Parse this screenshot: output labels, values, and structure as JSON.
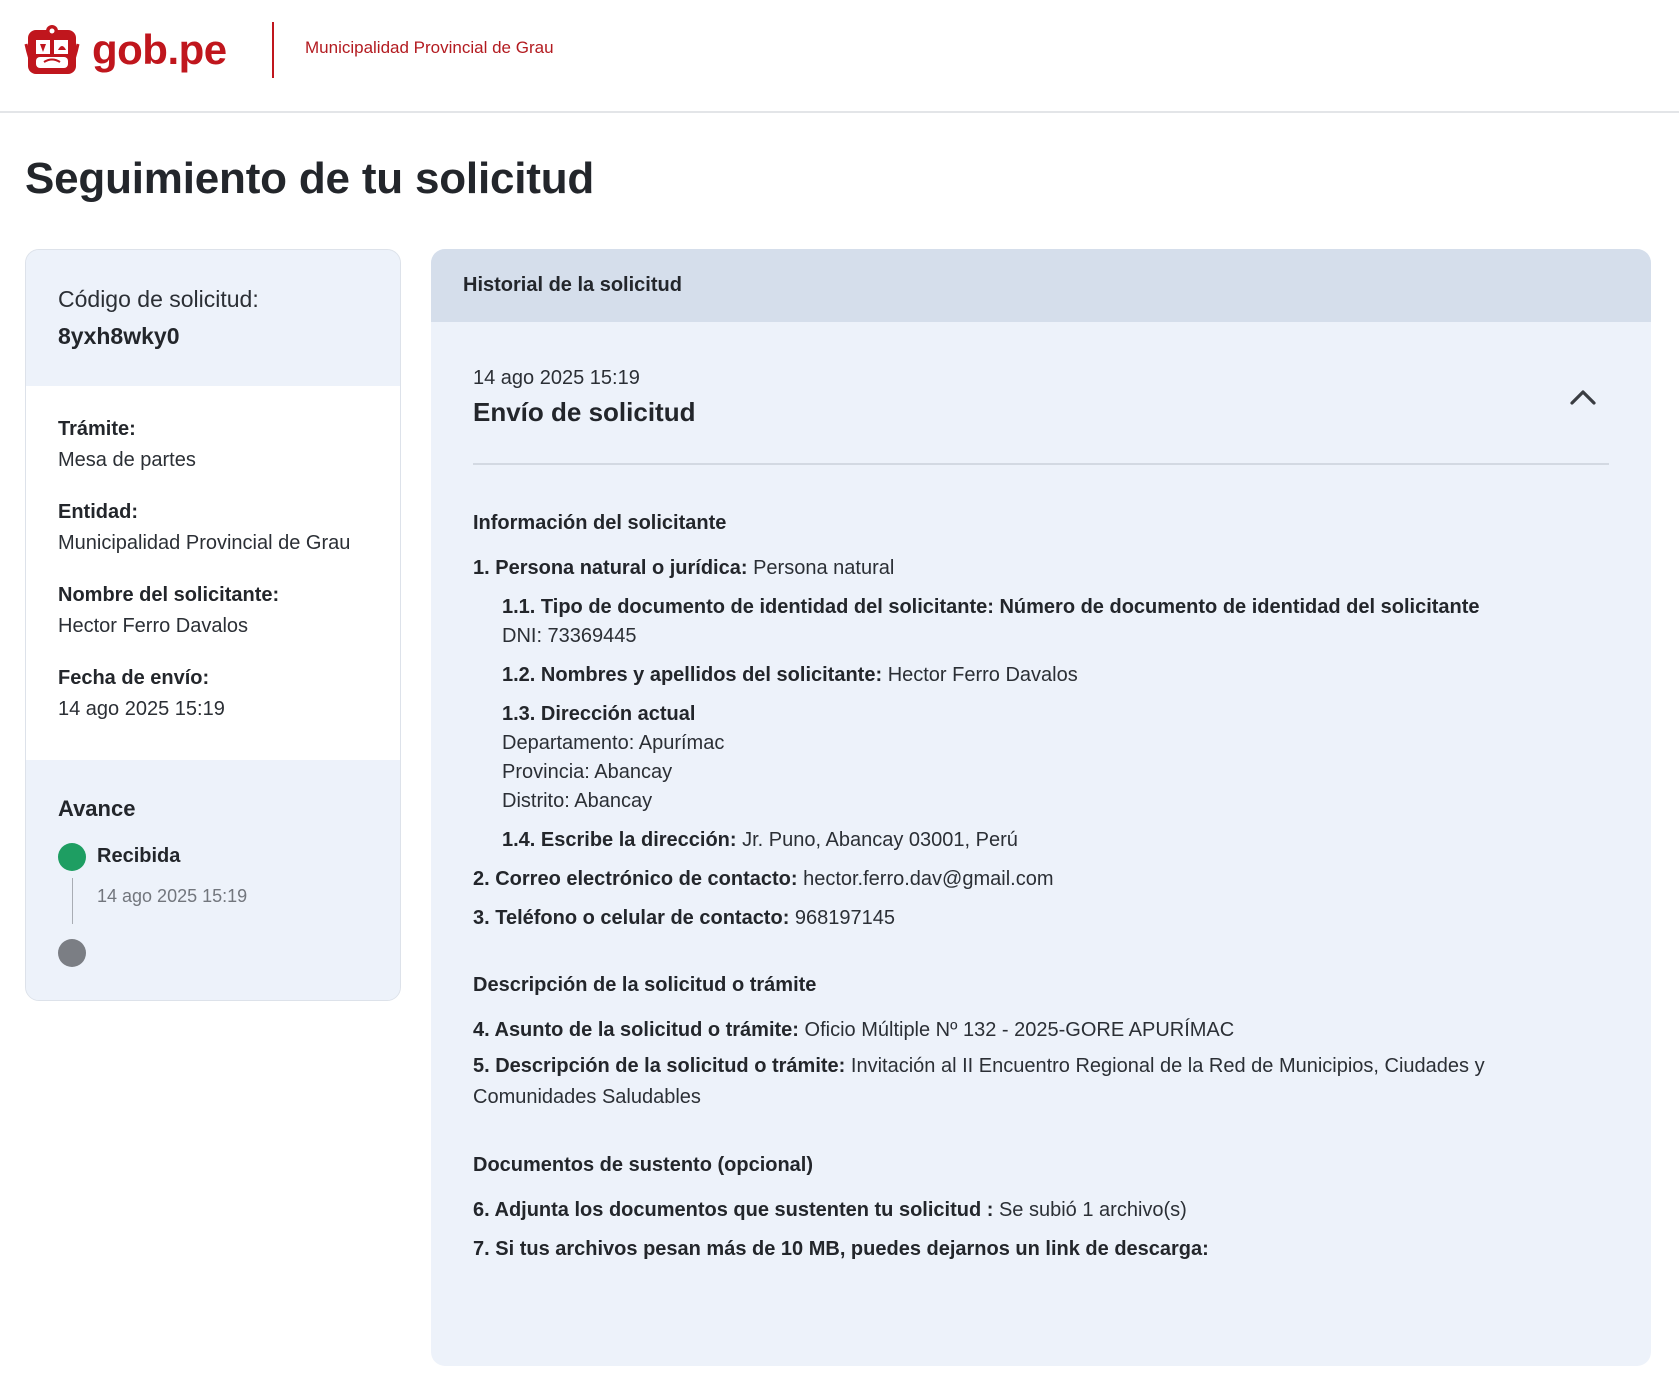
{
  "header": {
    "brand": "gob.pe",
    "entity_link": "Municipalidad Provincial de Grau"
  },
  "page_title": "Seguimiento de tu solicitud",
  "summary": {
    "code_label": "Código de solicitud:",
    "code_value": "8yxh8wky0",
    "details": [
      {
        "label": "Trámite:",
        "value": "Mesa de partes"
      },
      {
        "label": "Entidad:",
        "value": "Municipalidad Provincial de Grau"
      },
      {
        "label": "Nombre del solicitante:",
        "value": "Hector Ferro Davalos"
      },
      {
        "label": "Fecha de envío:",
        "value": "14 ago 2025 15:19"
      }
    ],
    "progress": {
      "title": "Avance",
      "steps": [
        {
          "label": "Recibida",
          "date": "14 ago 2025 15:19",
          "status": "done",
          "color": "#1e9e62"
        },
        {
          "label": "",
          "date": "",
          "status": "pending",
          "color": "#7b7e84"
        }
      ]
    }
  },
  "history": {
    "header": "Historial de la solicitud",
    "entry": {
      "date": "14 ago 2025 15:19",
      "title": "Envío de solicitud",
      "toggle_icon": "chevron-up-icon",
      "applicant_section": "Información del solicitante",
      "q1_label": "1. Persona natural o jurídica:",
      "q1_value": "Persona natural",
      "q11_label": "1.1. Tipo de documento de identidad del solicitante: Número de documento de identidad del solicitante",
      "q11_value": "DNI: 73369445",
      "q12_label": "1.2. Nombres y apellidos del solicitante:",
      "q12_value": "Hector Ferro Davalos",
      "q13_label": "1.3. Dirección actual",
      "q13_departamento": "Departamento: Apurímac",
      "q13_provincia": "Provincia: Abancay",
      "q13_distrito": "Distrito: Abancay",
      "q14_label": "1.4. Escribe la dirección:",
      "q14_value": "Jr. Puno, Abancay 03001, Perú",
      "q2_label": "2. Correo electrónico de contacto:",
      "q2_value": "hector.ferro.dav@gmail.com",
      "q3_label": "3. Teléfono o celular de contacto:",
      "q3_value": "968197145",
      "description_section": "Descripción de la solicitud o trámite",
      "q4_label": "4. Asunto de la solicitud o trámite:",
      "q4_value": "Oficio Múltiple Nº 132 - 2025-GORE APURÍMAC",
      "q5_label": "5. Descripción de la solicitud o trámite:",
      "q5_value": "Invitación al II Encuentro Regional de la Red de Municipios, Ciudades y Comunidades Saludables",
      "documents_section": "Documentos de sustento (opcional)",
      "q6_label": "6. Adjunta los documentos que sustenten tu solicitud :",
      "q6_value": "Se subió 1 archivo(s)",
      "q7_label": "7. Si tus archivos pesan más de 10 MB, puedes dejarnos un link de descarga:",
      "q7_value": ""
    }
  },
  "colors": {
    "brand_red": "#c0161d",
    "panel_bg": "#edf2fa",
    "panel_header_bg": "#d5deeb",
    "success_green": "#1e9e62",
    "pending_gray": "#7b7e84"
  }
}
